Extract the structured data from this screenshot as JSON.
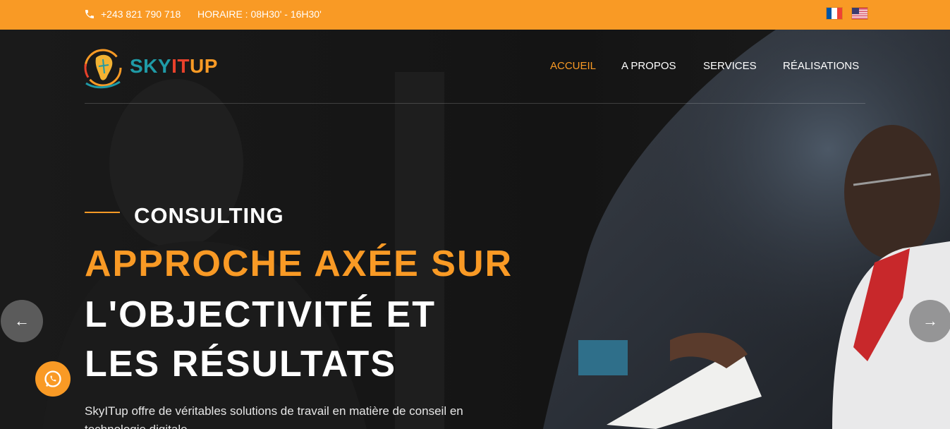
{
  "topbar": {
    "phone": "+243 821 790 718",
    "hours": "HORAIRE : 08H30' - 16H30'",
    "icons": [
      "phone-icon",
      "flag-fr-icon",
      "flag-us-icon"
    ]
  },
  "brand": {
    "part1": "SKY",
    "part2": "IT",
    "part3": "UP",
    "colors": {
      "sky": "#1f9aa6",
      "it": "#e8412b",
      "up": "#f99a25"
    }
  },
  "nav": {
    "items": [
      "ACCUEIL",
      "A PROPOS",
      "SERVICES",
      "RÉALISATIONS"
    ],
    "active_index": 0
  },
  "slide": {
    "kicker": "CONSULTING",
    "headline_1": "APPROCHE AXÉE SUR",
    "headline_2": "L'OBJECTIVITÉ ET",
    "headline_3": "LES RÉSULTATS",
    "description": "SkyITup offre de véritables solutions de travail en matière de conseil en technologie digitale."
  },
  "controls": {
    "prev_arrow": "←",
    "next_arrow": "→",
    "whatsapp": "whatsapp-icon"
  },
  "colors": {
    "accent": "#f99a25",
    "topbar": "#f99a25",
    "hero_bg": "#141414"
  }
}
